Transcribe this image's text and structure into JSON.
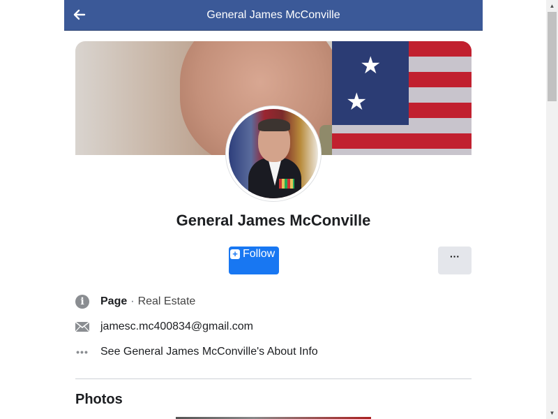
{
  "header": {
    "title": "General James McConville",
    "back_icon": "arrow-left-icon"
  },
  "profile": {
    "name": "General James McConville",
    "follow_label": "Follow",
    "follow_icon": "follow-plus-icon",
    "more_label": "···"
  },
  "info": {
    "page_label": "Page",
    "separator": "·",
    "category": "Real Estate",
    "email": "jamesc.mc400834@gmail.com",
    "about_link": "See General James McConville's About Info"
  },
  "photos": {
    "title": "Photos"
  },
  "colors": {
    "header_bg": "#3b5998",
    "follow_bg": "#1877f2",
    "more_bg": "#e4e6eb",
    "icon_gray": "#8a8d91"
  }
}
